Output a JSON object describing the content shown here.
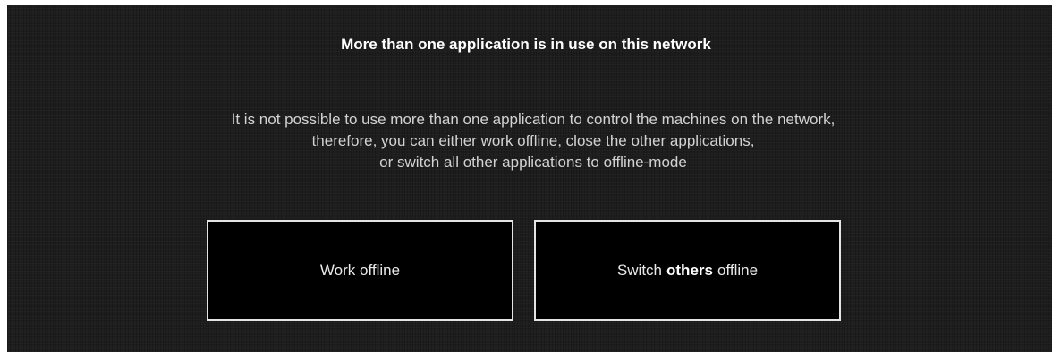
{
  "dialog": {
    "title": "More than one application is in use on this network",
    "message_lines": [
      "It is not possible to use more than one application to control the machines on the network,",
      "therefore, you can either work offline, close the other applications,",
      "or switch all other applications to offline-mode"
    ]
  },
  "buttons": {
    "work_offline": "Work offline",
    "switch_prefix": "Switch",
    "switch_emphasis": "others",
    "switch_suffix": "offline"
  }
}
